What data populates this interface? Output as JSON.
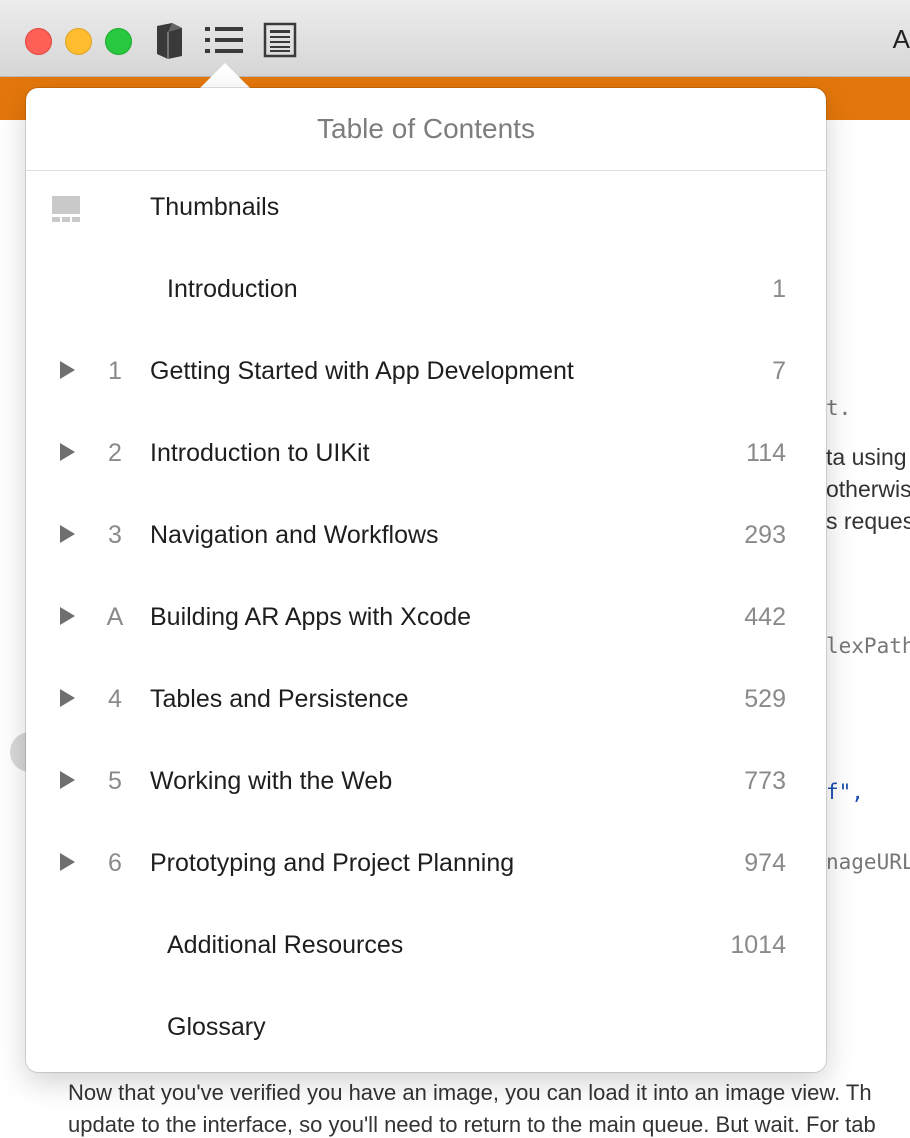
{
  "window": {
    "title_partial": "A",
    "toolbar_icons": [
      "book-icon",
      "list-icon",
      "page-icon"
    ]
  },
  "background": {
    "right_text": [
      "t.",
      "ta using",
      "otherwis",
      "s reques"
    ],
    "right_code": [
      "lexPath",
      "f\",",
      "nageURL"
    ],
    "bottom_paragraph": [
      "Now that you've verified you have an image, you can load it into an image view. Th",
      "update to the interface, so you'll need to return to the main queue. But wait. For tab"
    ]
  },
  "toc": {
    "title": "Table of Contents",
    "thumbnails_label": "Thumbnails",
    "items": [
      {
        "num": "",
        "label": "Introduction",
        "page": "1",
        "expandable": false
      },
      {
        "num": "1",
        "label": "Getting Started with App Development",
        "page": "7",
        "expandable": true
      },
      {
        "num": "2",
        "label": "Introduction to UIKit",
        "page": "114",
        "expandable": true
      },
      {
        "num": "3",
        "label": "Navigation and Workflows",
        "page": "293",
        "expandable": true
      },
      {
        "num": "A",
        "label": "Building AR Apps with Xcode",
        "page": "442",
        "expandable": true
      },
      {
        "num": "4",
        "label": "Tables and Persistence",
        "page": "529",
        "expandable": true
      },
      {
        "num": "5",
        "label": "Working with the Web",
        "page": "773",
        "expandable": true
      },
      {
        "num": "6",
        "label": "Prototyping and Project Planning",
        "page": "974",
        "expandable": true
      },
      {
        "num": "",
        "label": "Additional Resources",
        "page": "1014",
        "expandable": false
      },
      {
        "num": "",
        "label": "Glossary",
        "page": "",
        "expandable": false
      }
    ]
  },
  "colors": {
    "accent_orange": "#e4770b",
    "close": "#fe5f57",
    "minimize": "#febc2e",
    "zoom": "#28c840"
  }
}
